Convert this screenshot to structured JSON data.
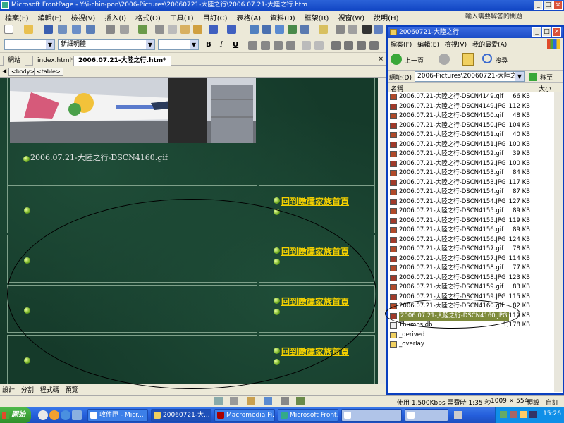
{
  "app_title": "Microsoft FrontPage - Y:\\i-chin-pon\\2006-Pictures\\20060721-大陸之行\\2006.07.21-大陸之行.htm",
  "menu": [
    "檔案(F)",
    "編輯(E)",
    "檢視(V)",
    "插入(I)",
    "格式(O)",
    "工具(T)",
    "目訂(C)",
    "表格(A)",
    "資料(D)",
    "框架(R)",
    "視窗(W)",
    "說明(H)"
  ],
  "help_placeholder": "輸入需要解答的問題",
  "format_bar": {
    "style_value": "",
    "font_value": "新細明體",
    "size_value": "",
    "bold": "B",
    "italic": "I",
    "underline": "U"
  },
  "tabs": {
    "web_label": "網站",
    "tab1": "index.html*",
    "tab2": "2006.07.21-大陸之行.htm*"
  },
  "tags": [
    "<body>",
    "<table>"
  ],
  "editor": {
    "caption": "2006.07.21-大陸之行-DSCN4160.gif",
    "home_link": "回到暾礵家族首頁"
  },
  "view_tabs": [
    "設計",
    "分割",
    "程式碼",
    "預覽"
  ],
  "status_bar": {
    "speed": "使用 1,500Kbps 需費時 1:35 秒",
    "dimensions": "1009 × 554",
    "default": "預設",
    "custom": "自訂"
  },
  "explorer": {
    "title": "20060721-大陸之行",
    "menu": [
      "檔案(F)",
      "編輯(E)",
      "檢視(V)",
      "我的最愛(A)"
    ],
    "back_label": "上一頁",
    "search_label": "搜尋",
    "address_label": "網址(D)",
    "address_value": "2006-Pictures\\20060721-大陸之行",
    "go_label": "移至",
    "col_name": "名稱",
    "col_size": "大小",
    "files": [
      {
        "name": "2006.07.21-大陸之行-DSCN4149.gif",
        "size": "66 KB",
        "type": "gif"
      },
      {
        "name": "2006.07.21-大陸之行-DSCN4149.JPG",
        "size": "112 KB",
        "type": "jpg"
      },
      {
        "name": "2006.07.21-大陸之行-DSCN4150.gif",
        "size": "48 KB",
        "type": "gif"
      },
      {
        "name": "2006.07.21-大陸之行-DSCN4150.JPG",
        "size": "104 KB",
        "type": "jpg"
      },
      {
        "name": "2006.07.21-大陸之行-DSCN4151.gif",
        "size": "40 KB",
        "type": "gif"
      },
      {
        "name": "2006.07.21-大陸之行-DSCN4151.JPG",
        "size": "100 KB",
        "type": "jpg"
      },
      {
        "name": "2006.07.21-大陸之行-DSCN4152.gif",
        "size": "39 KB",
        "type": "gif"
      },
      {
        "name": "2006.07.21-大陸之行-DSCN4152.JPG",
        "size": "100 KB",
        "type": "jpg"
      },
      {
        "name": "2006.07.21-大陸之行-DSCN4153.gif",
        "size": "84 KB",
        "type": "gif"
      },
      {
        "name": "2006.07.21-大陸之行-DSCN4153.JPG",
        "size": "117 KB",
        "type": "jpg"
      },
      {
        "name": "2006.07.21-大陸之行-DSCN4154.gif",
        "size": "87 KB",
        "type": "gif"
      },
      {
        "name": "2006.07.21-大陸之行-DSCN4154.JPG",
        "size": "127 KB",
        "type": "jpg"
      },
      {
        "name": "2006.07.21-大陸之行-DSCN4155.gif",
        "size": "89 KB",
        "type": "gif"
      },
      {
        "name": "2006.07.21-大陸之行-DSCN4155.JPG",
        "size": "119 KB",
        "type": "jpg"
      },
      {
        "name": "2006.07.21-大陸之行-DSCN4156.gif",
        "size": "89 KB",
        "type": "gif"
      },
      {
        "name": "2006.07.21-大陸之行-DSCN4156.JPG",
        "size": "124 KB",
        "type": "jpg"
      },
      {
        "name": "2006.07.21-大陸之行-DSCN4157.gif",
        "size": "78 KB",
        "type": "gif"
      },
      {
        "name": "2006.07.21-大陸之行-DSCN4157.JPG",
        "size": "114 KB",
        "type": "jpg"
      },
      {
        "name": "2006.07.21-大陸之行-DSCN4158.gif",
        "size": "77 KB",
        "type": "gif"
      },
      {
        "name": "2006.07.21-大陸之行-DSCN4158.JPG",
        "size": "123 KB",
        "type": "jpg"
      },
      {
        "name": "2006.07.21-大陸之行-DSCN4159.gif",
        "size": "83 KB",
        "type": "gif"
      },
      {
        "name": "2006.07.21-大陸之行-DSCN4159.JPG",
        "size": "115 KB",
        "type": "jpg"
      },
      {
        "name": "2006.07.21-大陸之行-DSCN4160.gif",
        "size": "82 KB",
        "type": "gif"
      },
      {
        "name": "2006.07.21-大陸之行-DSCN4160.JPG",
        "size": "112 KB",
        "type": "jpg",
        "selected": true
      },
      {
        "name": "Thumbs.db",
        "size": "1,178 KB",
        "type": "db"
      },
      {
        "name": "_derived",
        "size": "",
        "type": "folder"
      },
      {
        "name": "_overlay",
        "size": "",
        "type": "folder"
      }
    ]
  },
  "taskbar": {
    "start": "開始",
    "tasks": [
      "收件匣 - Micr...",
      "20060721-大...",
      "Macromedia Fi...",
      "Microsoft Front..."
    ],
    "clock": "15:26"
  },
  "colors": {
    "link_yellow": "#f4d000",
    "editor_bg": "#153a2a",
    "title_blue": "#1b4cc6",
    "selection_olive": "#7d8a3a"
  }
}
